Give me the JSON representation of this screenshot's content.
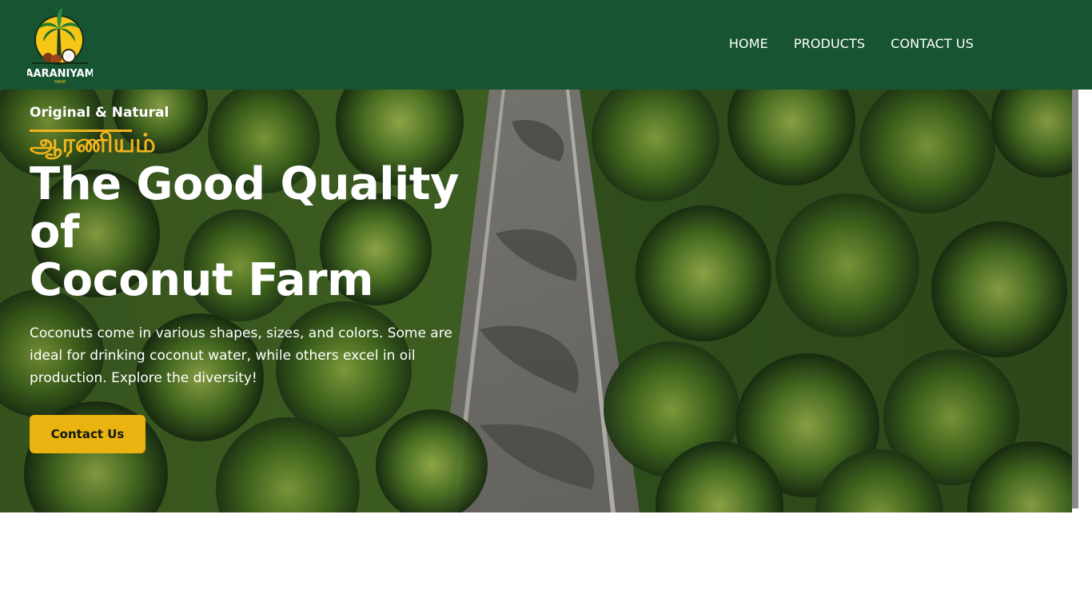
{
  "brand": {
    "logo_text": "AARANIYAM",
    "logo_sub": "FARM"
  },
  "nav": {
    "items": [
      {
        "label": "HOME"
      },
      {
        "label": "PRODUCTS"
      },
      {
        "label": "CONTACT US"
      }
    ]
  },
  "hero": {
    "eyebrow": "Original & Natural",
    "tamil_title": "ஆரணியம்",
    "headline_line1": "The Good Quality of",
    "headline_line2": "Coconut Farm",
    "description": "Coconuts come in various shapes, sizes, and colors. Some are ideal for drinking coconut water, while others excel in oil production. Explore the diversity!",
    "cta_label": "Contact Us"
  },
  "colors": {
    "header_bg": "#175532",
    "accent": "#f2b41c",
    "button_bg": "#eab30f"
  }
}
